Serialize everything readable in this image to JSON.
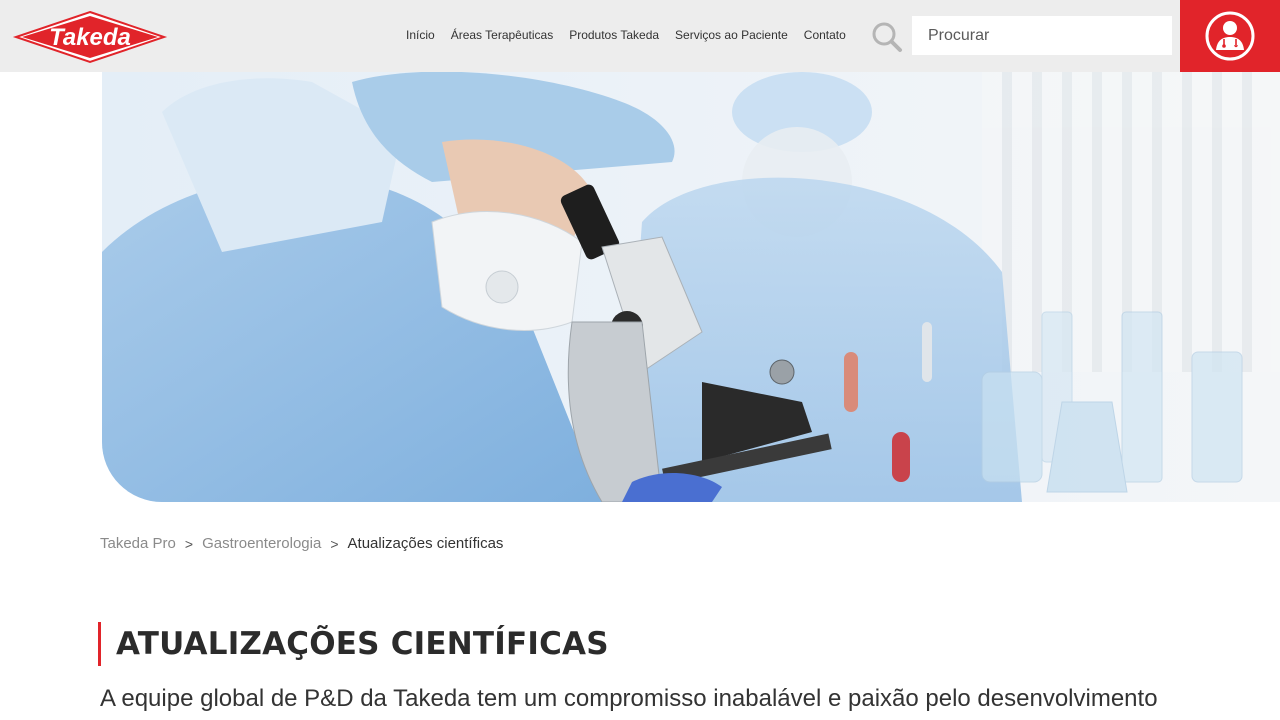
{
  "brand": {
    "logo_text": "Takeda",
    "accent_color": "#e1242a"
  },
  "nav": [
    {
      "label": "Início"
    },
    {
      "label": "Áreas Terapêuticas"
    },
    {
      "label": "Produtos Takeda"
    },
    {
      "label": "Serviços ao Paciente"
    },
    {
      "label": "Contato"
    }
  ],
  "search": {
    "placeholder": "Procurar",
    "icon": "search-icon"
  },
  "hcp_button": {
    "icon": "doctor-icon"
  },
  "hero": {
    "image": "lab-scientist-microscope"
  },
  "breadcrumb": {
    "items": [
      "Takeda Pro",
      "Gastroenterologia",
      "Atualizações científicas"
    ],
    "separator": ">"
  },
  "page": {
    "title": "ATUALIZAÇÕES CIENTÍFICAS",
    "intro": "A equipe global de P&D da Takeda tem um compromisso inabalável e paixão pelo desenvolvimento"
  }
}
